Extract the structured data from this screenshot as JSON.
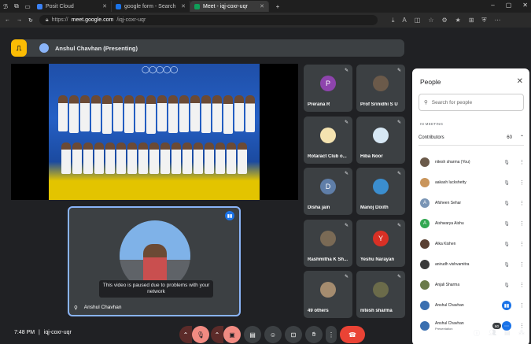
{
  "browser": {
    "tabs": [
      {
        "label": "Posit Cloud",
        "fav": "#3b82f6"
      },
      {
        "label": "google form - Search",
        "fav": "#1a73e8"
      },
      {
        "label": "Meet - iqj-coxr-uqr",
        "fav": "#0f9d58"
      }
    ],
    "url_prefix": "https://",
    "url_domain": "meet.google.com",
    "url_path": "/iqj-coxr-uqr",
    "new_tab": "+",
    "win_controls": [
      "–",
      "▢",
      "✕"
    ]
  },
  "presenting_banner": {
    "badge": "⎍",
    "text": "Anshul Chavhan (Presenting)"
  },
  "presentation": {
    "olympic_rings": "◯◯◯◯◯"
  },
  "self_tile": {
    "paused_message": "This video is paused due to problems with your network",
    "name": "Anshul Chavhan",
    "pin_icon": "⚲"
  },
  "tiles": [
    {
      "name": "Prerana R",
      "initial": "P",
      "color": "#8e44ad"
    },
    {
      "name": "Prof Srinidhi S U",
      "initial": "",
      "color": "#6b5a4a"
    },
    {
      "name": "Rotaract Club o...",
      "initial": "",
      "color": "#f4e3b0"
    },
    {
      "name": "Hiba Noor",
      "initial": "",
      "color": "#d7e8f5"
    },
    {
      "name": "Disha jain",
      "initial": "D",
      "color": "#5f7ea8"
    },
    {
      "name": "Manoj Dixith",
      "initial": "",
      "color": "#3b8ecf"
    },
    {
      "name": "Rashmitha K Sh...",
      "initial": "",
      "color": "#7a6a55"
    },
    {
      "name": "Yeshu Narayan",
      "initial": "Y",
      "color": "#d93025"
    },
    {
      "name": "49 others",
      "initial": "",
      "color": "#a58c6f"
    },
    {
      "name": "nitesh sharma",
      "initial": "",
      "color": "#6b6b4a"
    }
  ],
  "people_panel": {
    "title": "People",
    "close": "✕",
    "search_placeholder": "Search for people",
    "section_label": "IN MEETING",
    "contributors_label": "Contributors",
    "contributors_count": "60",
    "chevron": "⌃",
    "list": [
      {
        "name": "nitesh sharma (You)",
        "sub": "",
        "initial": "",
        "color": "#6b5a4a",
        "status": "muted"
      },
      {
        "name": "aakash luckshetty",
        "sub": "",
        "initial": "",
        "color": "#c9955b",
        "status": "muted"
      },
      {
        "name": "Afsheen Sehar",
        "sub": "",
        "initial": "A",
        "color": "#7a95b5",
        "status": "muted"
      },
      {
        "name": "Aishwarya Aishu",
        "sub": "",
        "initial": "A",
        "color": "#33a852",
        "status": "muted"
      },
      {
        "name": "Alka Kishen",
        "sub": "",
        "initial": "",
        "color": "#5a4033",
        "status": "muted"
      },
      {
        "name": "anirudh vishvamitra",
        "sub": "",
        "initial": "",
        "color": "#3a3a3a",
        "status": "muted"
      },
      {
        "name": "Anjali Sharma",
        "sub": "",
        "initial": "",
        "color": "#6a7a4a",
        "status": "muted"
      },
      {
        "name": "Anshul Chavhan",
        "sub": "",
        "initial": "",
        "color": "#3a6fb0",
        "status": "active"
      },
      {
        "name": "Anshul Chavhan",
        "sub": "Presentation",
        "initial": "",
        "color": "#3a6fb0",
        "status": "pres"
      }
    ]
  },
  "toolbar": {
    "time": "7:48 PM",
    "separator": "|",
    "meeting_code": "iqj-coxr-uqr",
    "people_count": "60"
  }
}
